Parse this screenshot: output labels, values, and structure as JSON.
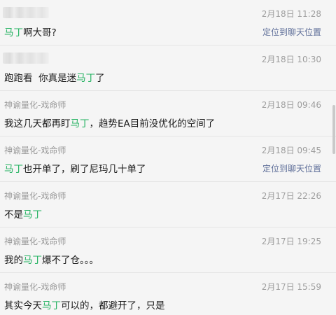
{
  "results": [
    {
      "sender": "",
      "time": "2月18日 11:28",
      "message": {
        "pre": "",
        "kw": "马丁",
        "post": "啊大哥?"
      },
      "locate_label": "定位到聊天位置"
    },
    {
      "sender": "",
      "time": "2月18日 10:30",
      "message": {
        "pre": "跑跑看  你真是迷",
        "kw": "马丁",
        "post": "了"
      },
      "locate_label": ""
    },
    {
      "sender": "神谕量化-戏命师",
      "time": "2月18日 09:46",
      "message": {
        "pre": "我这几天都再盯",
        "kw": "马丁",
        "post": "，趋势EA目前没优化的空间了"
      },
      "locate_label": ""
    },
    {
      "sender": "神谕量化-戏命师",
      "time": "2月18日 09:45",
      "message": {
        "pre": "",
        "kw": "马丁",
        "post": "也开单了，刷了尼玛几十单了"
      },
      "locate_label": "定位到聊天位置"
    },
    {
      "sender": "神谕量化-戏命师",
      "time": "2月17日 22:26",
      "message": {
        "pre": "不是",
        "kw": "马丁",
        "post": ""
      },
      "locate_label": ""
    },
    {
      "sender": "神谕量化-戏命师",
      "time": "2月17日 19:25",
      "message": {
        "pre": "我的",
        "kw": "马丁",
        "post": "爆不了仓。。。"
      },
      "locate_label": ""
    },
    {
      "sender": "神谕量化-戏命师",
      "time": "2月17日 15:59",
      "message": {
        "pre": "其实今天",
        "kw": "马丁",
        "post": "可以的，都避开了，只是"
      },
      "locate_label": ""
    }
  ],
  "colors": {
    "keyword": "#21b15f",
    "locate_link": "#5f6f99",
    "background": "#f5f5f5"
  }
}
